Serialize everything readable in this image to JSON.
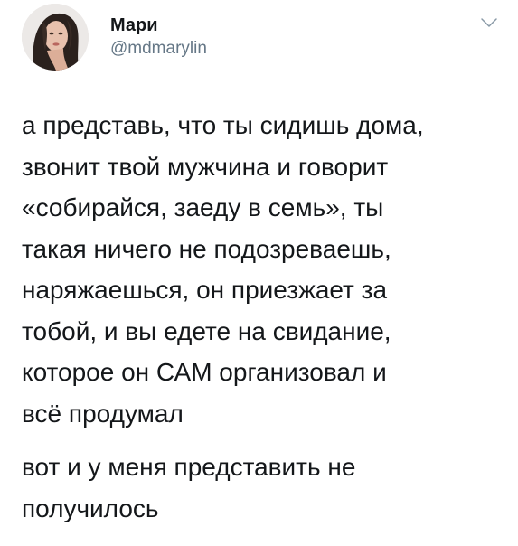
{
  "tweet": {
    "author": {
      "display_name": "Мари",
      "handle": "@mdmarylin"
    },
    "menu_icon": "chevron-down-icon",
    "paragraphs": [
      "а представь, что ты сидишь дома,\nзвонит твой мужчина и говорит\n«собирайся, заеду в семь», ты\nтакая ничего не подозреваешь,\nнаряжаешься, он приезжает за\nтобой, и вы едете на свидание,\nкоторое он САМ организовал и\nвсё продумал",
      "вот и у меня представить не\nполучилось"
    ]
  }
}
